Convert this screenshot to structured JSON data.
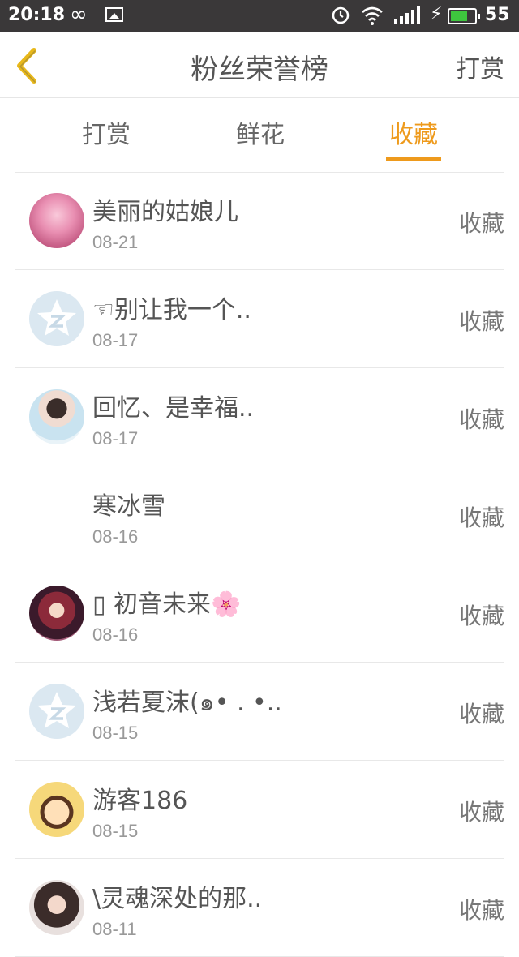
{
  "status_bar": {
    "time": "20:18",
    "battery_percent": "55",
    "battery_level": 0.75,
    "battery_color": "#3ec63e"
  },
  "header": {
    "title": "粉丝荣誉榜",
    "action": "打赏"
  },
  "tabs": [
    {
      "label": "打赏",
      "active": false
    },
    {
      "label": "鲜花",
      "active": false
    },
    {
      "label": "收藏",
      "active": true
    }
  ],
  "accent_color": "#ee9a1c",
  "list": [
    {
      "name": "美丽的姑娘儿",
      "date": "08-21",
      "action": "收藏",
      "avatar": "pink-anime-avatar"
    },
    {
      "name": "☜别让我一个..",
      "date": "08-17",
      "action": "收藏",
      "avatar": "qq-default-avatar"
    },
    {
      "name": "回忆、是幸福..",
      "date": "08-17",
      "action": "收藏",
      "avatar": "boy-photo-avatar"
    },
    {
      "name": "寒冰雪",
      "date": "08-16",
      "action": "收藏",
      "avatar": "none"
    },
    {
      "name": "▯ 初音未来🌸",
      "date": "08-16",
      "action": "收藏",
      "avatar": "anime-girl-avatar"
    },
    {
      "name": "浅若夏沫(๑• . •..",
      "date": "08-15",
      "action": "收藏",
      "avatar": "qq-default-avatar"
    },
    {
      "name": "游客186",
      "date": "08-15",
      "action": "收藏",
      "avatar": "cartoon-avatar"
    },
    {
      "name": "\\灵魂深处的那..",
      "date": "08-11",
      "action": "收藏",
      "avatar": "girl-photo-avatar"
    }
  ]
}
